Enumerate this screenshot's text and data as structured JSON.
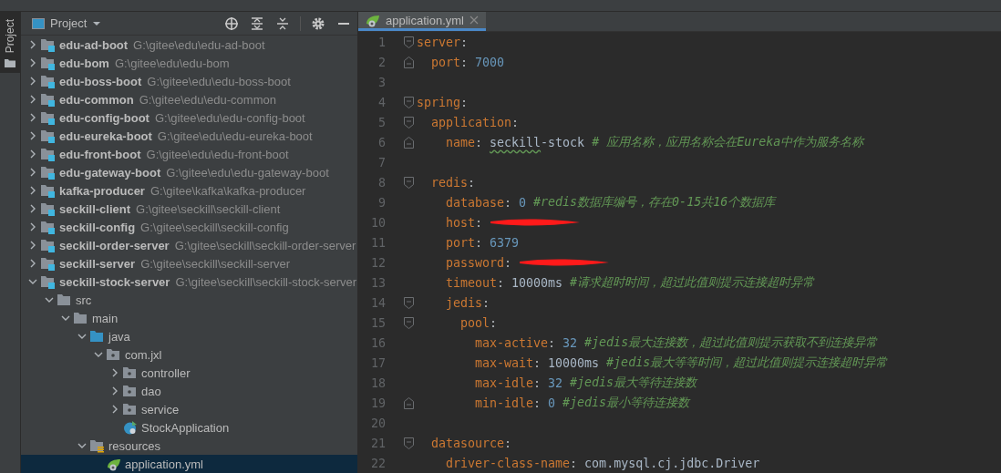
{
  "tool_strip": {
    "label": "Project",
    "selected": true
  },
  "project_panel": {
    "title": "Project",
    "tree": [
      {
        "kind": "module",
        "name": "edu-ad-boot",
        "path": "G:\\gitee\\edu\\edu-ad-boot",
        "expanded": false,
        "selected": false
      },
      {
        "kind": "module",
        "name": "edu-bom",
        "path": "G:\\gitee\\edu\\edu-bom",
        "expanded": false,
        "selected": false
      },
      {
        "kind": "module",
        "name": "edu-boss-boot",
        "path": "G:\\gitee\\edu\\edu-boss-boot",
        "expanded": false,
        "selected": false
      },
      {
        "kind": "module",
        "name": "edu-common",
        "path": "G:\\gitee\\edu\\edu-common",
        "expanded": false,
        "selected": false
      },
      {
        "kind": "module",
        "name": "edu-config-boot",
        "path": "G:\\gitee\\edu\\edu-config-boot",
        "expanded": false,
        "selected": false
      },
      {
        "kind": "module",
        "name": "edu-eureka-boot",
        "path": "G:\\gitee\\edu\\edu-eureka-boot",
        "expanded": false,
        "selected": false
      },
      {
        "kind": "module",
        "name": "edu-front-boot",
        "path": "G:\\gitee\\edu\\edu-front-boot",
        "expanded": false,
        "selected": false
      },
      {
        "kind": "module",
        "name": "edu-gateway-boot",
        "path": "G:\\gitee\\edu\\edu-gateway-boot",
        "expanded": false,
        "selected": false
      },
      {
        "kind": "module",
        "name": "kafka-producer",
        "path": "G:\\gitee\\kafka\\kafka-producer",
        "expanded": false,
        "selected": false
      },
      {
        "kind": "module",
        "name": "seckill-client",
        "path": "G:\\gitee\\seckill\\seckill-client",
        "expanded": false,
        "selected": false
      },
      {
        "kind": "module",
        "name": "seckill-config",
        "path": "G:\\gitee\\seckill\\seckill-config",
        "expanded": false,
        "selected": false
      },
      {
        "kind": "module",
        "name": "seckill-order-server",
        "path": "G:\\gitee\\seckill\\seckill-order-server",
        "expanded": false,
        "selected": false
      },
      {
        "kind": "module",
        "name": "seckill-server",
        "path": "G:\\gitee\\seckill\\seckill-server",
        "expanded": false,
        "selected": false
      },
      {
        "kind": "module",
        "name": "seckill-stock-server",
        "path": "G:\\gitee\\seckill\\seckill-stock-server",
        "expanded": true,
        "selected": false,
        "children": [
          {
            "kind": "folder",
            "name": "src",
            "expanded": true,
            "selected": false,
            "children": [
              {
                "kind": "folder",
                "name": "main",
                "expanded": true,
                "selected": false,
                "children": [
                  {
                    "kind": "source-folder",
                    "name": "java",
                    "expanded": true,
                    "selected": false,
                    "children": [
                      {
                        "kind": "package",
                        "name": "com.jxl",
                        "expanded": true,
                        "selected": false,
                        "children": [
                          {
                            "kind": "package",
                            "name": "controller",
                            "expanded": false,
                            "selected": false
                          },
                          {
                            "kind": "package",
                            "name": "dao",
                            "expanded": false,
                            "selected": false
                          },
                          {
                            "kind": "package",
                            "name": "service",
                            "expanded": false,
                            "selected": false
                          },
                          {
                            "kind": "app-class",
                            "name": "StockApplication",
                            "selected": false
                          }
                        ]
                      }
                    ]
                  },
                  {
                    "kind": "resources-folder",
                    "name": "resources",
                    "expanded": true,
                    "selected": false,
                    "children": [
                      {
                        "kind": "yaml-file",
                        "name": "application.yml",
                        "selected": true
                      }
                    ]
                  }
                ]
              }
            ]
          }
        ]
      }
    ]
  },
  "editor": {
    "tabs": [
      {
        "label": "application.yml",
        "selected": true
      }
    ],
    "lines": [
      {
        "number": "1",
        "fold_start": true,
        "tokens": [
          {
            "kind": "key",
            "text": "server"
          },
          {
            "kind": "punct",
            "text": ":"
          }
        ],
        "children": [
          {
            "number": "2",
            "fold_end": true,
            "tokens": [
              {
                "kind": "key",
                "text": "port"
              },
              {
                "kind": "punct",
                "text": ": "
              },
              {
                "kind": "number",
                "text": "7000"
              }
            ]
          }
        ]
      },
      {
        "number": "3"
      },
      {
        "number": "4",
        "fold_start": true,
        "tokens": [
          {
            "kind": "key",
            "text": "spring"
          },
          {
            "kind": "punct",
            "text": ":"
          }
        ],
        "children": [
          {
            "number": "5",
            "fold_start": true,
            "tokens": [
              {
                "kind": "key",
                "text": "application"
              },
              {
                "kind": "punct",
                "text": ":"
              }
            ],
            "children": [
              {
                "number": "6",
                "fold_end": true,
                "tokens": [
                  {
                    "kind": "key",
                    "text": "name"
                  },
                  {
                    "kind": "punct",
                    "text": ": "
                  },
                  {
                    "kind": "flagged",
                    "text": "seckill"
                  },
                  {
                    "kind": "plain",
                    "text": "-stock "
                  },
                  {
                    "kind": "comment",
                    "text": "# 应用名称，应用名称会在Eureka中作为服务名称"
                  }
                ]
              }
            ]
          },
          {
            "number": "7"
          },
          {
            "number": "8",
            "fold_start": true,
            "tokens": [
              {
                "kind": "key",
                "text": "redis"
              },
              {
                "kind": "punct",
                "text": ":"
              }
            ],
            "children": [
              {
                "number": "9",
                "tokens": [
                  {
                    "kind": "key",
                    "text": "database"
                  },
                  {
                    "kind": "punct",
                    "text": ": "
                  },
                  {
                    "kind": "number",
                    "text": "0"
                  },
                  {
                    "kind": "comment",
                    "text": " #redis数据库编号，存在0-15共16个数据库"
                  }
                ]
              },
              {
                "number": "10",
                "tokens": [
                  {
                    "kind": "key",
                    "text": "host"
                  },
                  {
                    "kind": "punct",
                    "text": ": "
                  },
                  {
                    "kind": "redacted"
                  }
                ]
              },
              {
                "number": "11",
                "tokens": [
                  {
                    "kind": "key",
                    "text": "port"
                  },
                  {
                    "kind": "punct",
                    "text": ": "
                  },
                  {
                    "kind": "number",
                    "text": "6379"
                  }
                ]
              },
              {
                "number": "12",
                "tokens": [
                  {
                    "kind": "key",
                    "text": "password"
                  },
                  {
                    "kind": "punct",
                    "text": ": "
                  },
                  {
                    "kind": "redacted"
                  }
                ]
              },
              {
                "number": "13",
                "tokens": [
                  {
                    "kind": "key",
                    "text": "timeout"
                  },
                  {
                    "kind": "punct",
                    "text": ": "
                  },
                  {
                    "kind": "plain",
                    "text": "10000ms "
                  },
                  {
                    "kind": "comment",
                    "text": "#请求超时时间，超过此值则提示连接超时异常"
                  }
                ]
              },
              {
                "number": "14",
                "fold_start": true,
                "tokens": [
                  {
                    "kind": "key",
                    "text": "jedis"
                  },
                  {
                    "kind": "punct",
                    "text": ":"
                  }
                ],
                "children": [
                  {
                    "number": "15",
                    "fold_start": true,
                    "tokens": [
                      {
                        "kind": "key",
                        "text": "pool"
                      },
                      {
                        "kind": "punct",
                        "text": ":"
                      }
                    ],
                    "children": [
                      {
                        "number": "16",
                        "tokens": [
                          {
                            "kind": "key",
                            "text": "max-active"
                          },
                          {
                            "kind": "punct",
                            "text": ": "
                          },
                          {
                            "kind": "number",
                            "text": "32"
                          },
                          {
                            "kind": "comment",
                            "text": " #jedis最大连接数，超过此值则提示获取不到连接异常"
                          }
                        ]
                      },
                      {
                        "number": "17",
                        "tokens": [
                          {
                            "kind": "key",
                            "text": "max-wait"
                          },
                          {
                            "kind": "punct",
                            "text": ": "
                          },
                          {
                            "kind": "plain",
                            "text": "10000ms "
                          },
                          {
                            "kind": "comment",
                            "text": "#jedis最大等等时间，超过此值则提示连接超时异常"
                          }
                        ]
                      },
                      {
                        "number": "18",
                        "tokens": [
                          {
                            "kind": "key",
                            "text": "max-idle"
                          },
                          {
                            "kind": "punct",
                            "text": ": "
                          },
                          {
                            "kind": "number",
                            "text": "32"
                          },
                          {
                            "kind": "comment",
                            "text": " #jedis最大等待连接数"
                          }
                        ]
                      },
                      {
                        "number": "19",
                        "fold_end": true,
                        "tokens": [
                          {
                            "kind": "key",
                            "text": "min-idle"
                          },
                          {
                            "kind": "punct",
                            "text": ": "
                          },
                          {
                            "kind": "number",
                            "text": "0"
                          },
                          {
                            "kind": "comment",
                            "text": " #jedis最小等待连接数"
                          }
                        ]
                      }
                    ]
                  }
                ]
              }
            ]
          },
          {
            "number": "20"
          },
          {
            "number": "21",
            "fold_start": true,
            "tokens": [
              {
                "kind": "key",
                "text": "datasource"
              },
              {
                "kind": "punct",
                "text": ":"
              }
            ],
            "children": [
              {
                "number": "22",
                "tokens": [
                  {
                    "kind": "key",
                    "text": "driver-class-name"
                  },
                  {
                    "kind": "punct",
                    "text": ": "
                  },
                  {
                    "kind": "plain",
                    "text": "com.mysql.cj.jdbc.Driver"
                  }
                ]
              }
            ]
          }
        ]
      }
    ]
  }
}
